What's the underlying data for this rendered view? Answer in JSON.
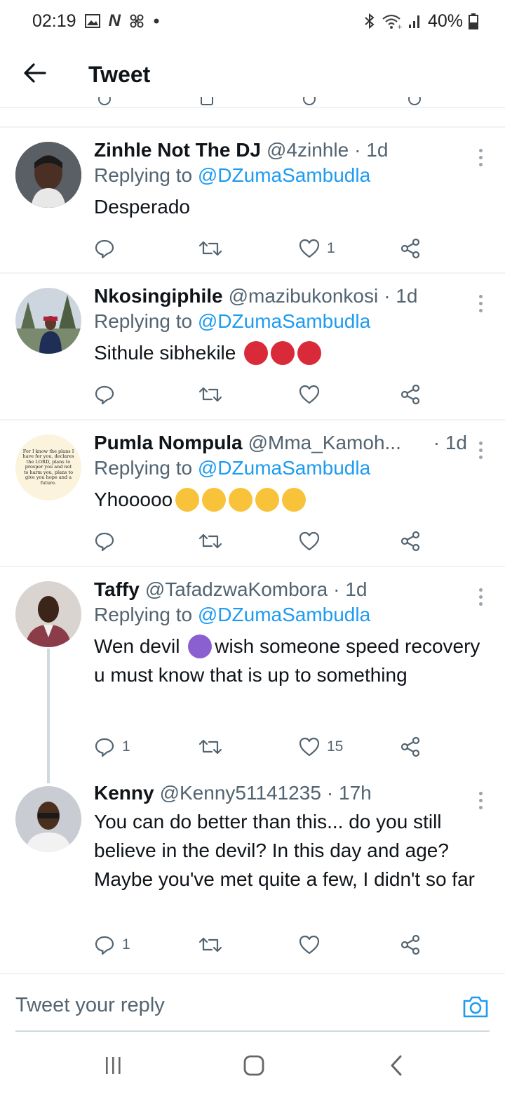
{
  "status_bar": {
    "time": "02:19",
    "battery": "40%",
    "left_icons": [
      "gallery-icon",
      "netflix-icon",
      "fan-icon",
      "dot-icon"
    ],
    "right_icons": [
      "bluetooth-icon",
      "wifi-icon",
      "signal-icon",
      "battery-icon"
    ]
  },
  "header": {
    "title": "Tweet"
  },
  "replies": [
    {
      "display_name": "Zinhle Not The DJ",
      "handle": "@4zinhle",
      "time": "· 1d",
      "replying_prefix": "Replying to ",
      "replying_to": "@DZumaSambudla",
      "text": "Desperado",
      "reply_count": "",
      "retweet_count": "",
      "like_count": "1"
    },
    {
      "display_name": "Nkosingiphile",
      "handle": "@mazibukonkosi",
      "time": "· 1d",
      "replying_prefix": "Replying to ",
      "replying_to": "@DZumaSambudla",
      "text": "Sithule sibhekile",
      "emoji": "angry-face x3",
      "reply_count": "",
      "retweet_count": "",
      "like_count": ""
    },
    {
      "display_name": "Pumla Nompula",
      "handle": "@Mma_Kamoh...",
      "time": "· 1d",
      "avatar_text": "For I know the plans I have for you, declares the LORD, plans to prosper you and not to harm you, plans to give you hope and a future.",
      "replying_prefix": "Replying to ",
      "replying_to": "@DZumaSambudla",
      "text": "Yhooooo",
      "emoji": "upside-down-face x5",
      "reply_count": "",
      "retweet_count": "",
      "like_count": ""
    },
    {
      "display_name": "Taffy",
      "handle": "@TafadzwaKombora",
      "time": "· 1d",
      "replying_prefix": "Replying to ",
      "replying_to": "@DZumaSambudla",
      "text_before": "Wen devil ",
      "text_after": "wish someone speed recovery u must know that is up to something",
      "emoji": "smiling-imp",
      "reply_count": "1",
      "retweet_count": "",
      "like_count": "15"
    },
    {
      "display_name": "Kenny",
      "handle": "@Kenny51141235",
      "time": "· 17h",
      "text": "You can do better than this... do you still believe in the devil? In this day and age? Maybe you've met quite a few, I didn't so far",
      "reply_count": "1",
      "retweet_count": "",
      "like_count": ""
    }
  ],
  "compose": {
    "placeholder": "Tweet your reply"
  },
  "colors": {
    "accent": "#1d9bf0",
    "secondary_text": "#536471",
    "divider": "#eff3f4"
  }
}
